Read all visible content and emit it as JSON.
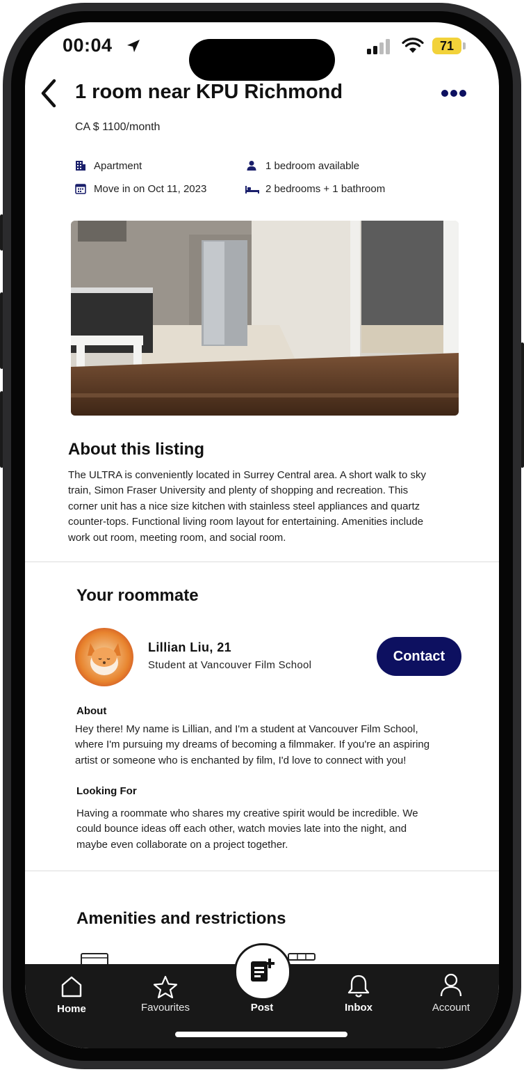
{
  "status_bar": {
    "time": "00:04",
    "battery": "71"
  },
  "header": {
    "title": "1 room near KPU Richmond",
    "price": "CA $ 1100/month"
  },
  "details": {
    "property_type": "Apartment",
    "move_in": "Move in on Oct 11, 2023",
    "availability": "1 bedroom available",
    "layout": "2 bedrooms + 1 bathroom"
  },
  "about_listing": {
    "heading": "About this listing",
    "lines": [
      "The ULTRA is conveniently located in Surrey Central area. A short walk to sky",
      "train, Simon Fraser University and plenty of shopping and recreation. This",
      "corner unit has a nice size kitchen with stainless steel appliances and quartz",
      "counter-tops. Functional living room layout for entertaining. Amenities include",
      "work out room, meeting room, and social room."
    ]
  },
  "roommate": {
    "heading": "Your roommate",
    "name": "Lillian Liu, 21",
    "occupation": "Student at Vancouver Film School",
    "contact_label": "Contact",
    "about_heading": "About",
    "about_lines": [
      "Hey there! My name is Lillian, and I'm a student at Vancouver Film School,",
      "where I'm pursuing my dreams of becoming a filmmaker. If you're an aspiring",
      "artist or someone who is enchanted by  film, I'd love to connect with you!"
    ],
    "looking_heading": "Looking For",
    "looking_lines": [
      "Having a roommate who shares my creative spirit would be incredible. We",
      "could bounce ideas off each other, watch movies late into the night, and",
      "maybe even collaborate on a project together."
    ]
  },
  "amenities": {
    "heading": "Amenities and restrictions"
  },
  "tabbar": {
    "home": "Home",
    "favourites": "Favourites",
    "post": "Post",
    "inbox": "Inbox",
    "account": "Account"
  },
  "colors": {
    "accent": "#0d1060",
    "tabbar_bg": "#181818",
    "battery": "#f2d23a"
  },
  "icons": {
    "back": "chevron-left-icon",
    "more": "ellipsis-icon",
    "apartment": "building-icon",
    "calendar": "calendar-icon",
    "person": "person-icon",
    "bed": "bed-icon",
    "home": "home-icon",
    "favourites": "star-icon",
    "post": "new-post-icon",
    "inbox": "bell-icon",
    "account": "user-icon"
  }
}
